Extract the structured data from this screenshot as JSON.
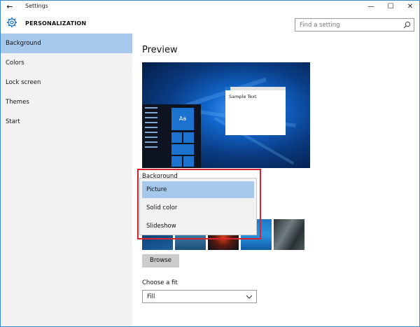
{
  "window": {
    "title": "Settings",
    "back_glyph": "←",
    "min_glyph": "—",
    "max_glyph": "☐",
    "close_glyph": "✕"
  },
  "header": {
    "section_title": "PERSONALIZATION",
    "icon": "gear-icon",
    "search_placeholder": "Find a setting",
    "search_icon": "search-icon"
  },
  "sidebar": {
    "items": [
      {
        "label": "Background",
        "selected": true
      },
      {
        "label": "Colors",
        "selected": false
      },
      {
        "label": "Lock screen",
        "selected": false
      },
      {
        "label": "Themes",
        "selected": false
      },
      {
        "label": "Start",
        "selected": false
      }
    ]
  },
  "main": {
    "preview_title": "Preview",
    "preview": {
      "tile_label": "Aa",
      "window_text": "Sample Text"
    },
    "background_label": "Background",
    "background_options": [
      {
        "label": "Picture",
        "selected": true
      },
      {
        "label": "Solid color",
        "selected": false
      },
      {
        "label": "Slideshow",
        "selected": false
      }
    ],
    "browse_label": "Browse",
    "fit_label": "Choose a fit",
    "fit_value": "Fill"
  },
  "colors": {
    "accent": "#a6c8ea",
    "highlight": "#d9232e",
    "window_border": "#3c8ad6"
  }
}
